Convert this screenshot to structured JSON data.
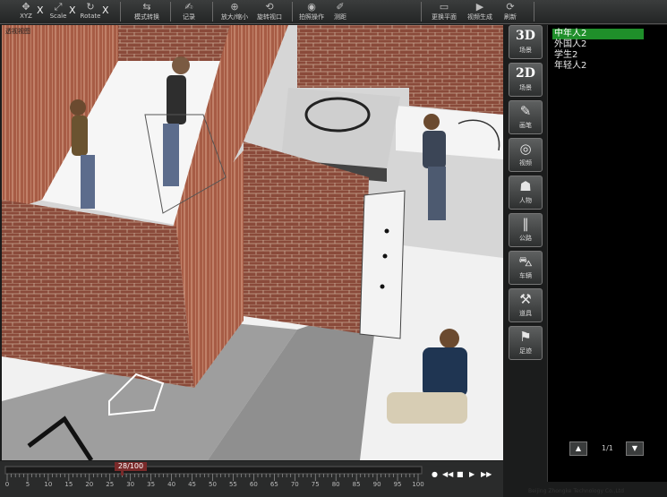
{
  "toolbar": {
    "axis_tools": [
      {
        "label": "XYZ",
        "close": "X",
        "icon": "move-icon"
      },
      {
        "label": "Scale",
        "close": "X",
        "icon": "scale-icon"
      },
      {
        "label": "Rotate",
        "close": "X",
        "icon": "rotate-icon"
      }
    ],
    "buttons": [
      {
        "label": "模式转换",
        "icon": "mode-switch-icon"
      },
      {
        "label": "记录",
        "icon": "record-icon"
      },
      {
        "label": "放大/缩小",
        "icon": "zoom-icon"
      },
      {
        "label": "旋转视口",
        "icon": "rotate-view-icon"
      },
      {
        "label": "拍照操作",
        "icon": "camera-icon"
      },
      {
        "label": "测距",
        "icon": "measure-icon"
      },
      {
        "label": "更换平面",
        "icon": "plane-icon"
      },
      {
        "label": "视频生成",
        "icon": "video-icon"
      },
      {
        "label": "刷新",
        "icon": "refresh-icon"
      }
    ]
  },
  "viewport": {
    "label": "透视视图"
  },
  "timeline": {
    "frame_readout": "28/100",
    "current_frame": 28,
    "total_frames": 100,
    "ticks": [
      "0",
      "5",
      "10",
      "15",
      "20",
      "25",
      "30",
      "35",
      "40",
      "45",
      "50",
      "55",
      "60",
      "65",
      "70",
      "75",
      "80",
      "85",
      "90",
      "95",
      "100"
    ],
    "buttons": [
      "●",
      "◀◀",
      "■",
      "▶",
      "▶▶"
    ]
  },
  "tools": [
    {
      "big": "3D",
      "label": "场景",
      "icon": "3d-scene-icon"
    },
    {
      "big": "2D",
      "label": "场景",
      "icon": "2d-scene-icon"
    },
    {
      "glyph": "✎",
      "label": "画笔",
      "icon": "brush-icon"
    },
    {
      "glyph": "◎",
      "label": "视频",
      "icon": "video-reel-icon"
    },
    {
      "glyph": "☗",
      "label": "人物",
      "icon": "people-icon"
    },
    {
      "glyph": "∥",
      "label": "公路",
      "icon": "road-icon"
    },
    {
      "glyph": "⛍",
      "label": "车辆",
      "icon": "car-icon"
    },
    {
      "glyph": "⚒",
      "label": "道具",
      "icon": "props-icon"
    },
    {
      "glyph": "⚑",
      "label": "足迹",
      "icon": "footprint-icon"
    }
  ],
  "list": {
    "items": [
      "中年人2",
      "外国人2",
      "学生2",
      "年轻人2"
    ],
    "selected_index": 0,
    "page": "1/1",
    "prev": "▲",
    "next": "▼"
  },
  "footer": {
    "copyright": "Beijing Zhongke Technology Co.,Ltd"
  },
  "colors": {
    "selected": "#1f8f2a",
    "brick": "#8a4a3a",
    "floor": "#efefef",
    "shadow": "#9a9a9a",
    "frame_marker": "#7a2a2a"
  }
}
